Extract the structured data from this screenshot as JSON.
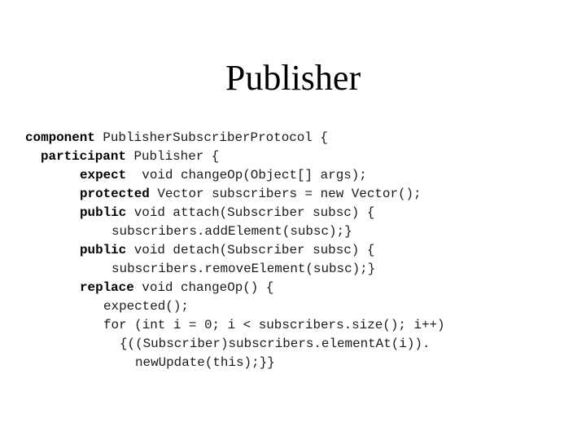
{
  "slide": {
    "title": "Publisher"
  },
  "code": {
    "lines": [
      {
        "keyword": "component",
        "rest": " PublisherSubscriberProtocol {"
      },
      {
        "keyword": "participant",
        "rest": " Publisher {"
      },
      {
        "keyword": "expect",
        "rest": "  void changeOp(Object[] args);"
      },
      {
        "keyword": "protected",
        "rest": " Vector subscribers = new Vector();"
      },
      {
        "keyword": "public",
        "rest": " void attach(Subscriber subsc) {"
      },
      {
        "keyword": "",
        "rest": "subscribers.addElement(subsc);}"
      },
      {
        "keyword": "public",
        "rest": " void detach(Subscriber subsc) {"
      },
      {
        "keyword": "",
        "rest": "subscribers.removeElement(subsc);}"
      },
      {
        "keyword": "replace",
        "rest": " void changeOp() {"
      },
      {
        "keyword": "",
        "rest": "expected();"
      },
      {
        "keyword": "",
        "rest": "for (int i = 0; i < subscribers.size(); i++)"
      },
      {
        "keyword": "",
        "rest": "{((Subscriber)subscribers.elementAt(i))."
      },
      {
        "keyword": "",
        "rest": "newUpdate(this);}}"
      }
    ]
  }
}
